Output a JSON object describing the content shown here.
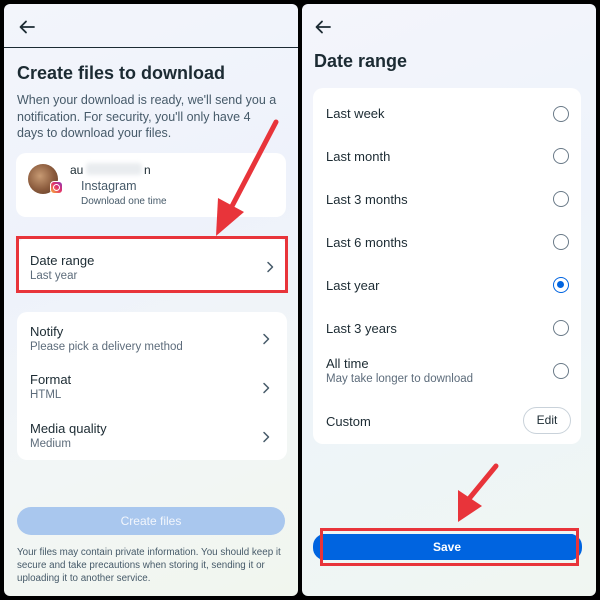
{
  "left": {
    "title": "Create files to download",
    "description": "When your download is ready, we'll send you a notification. For security, you'll only have 4 days to download your files.",
    "account": {
      "name_start": "au",
      "name_end": "n",
      "platform": "Instagram",
      "download_note": "Download one time"
    },
    "date_range": {
      "label": "Date range",
      "value": "Last year"
    },
    "settings": [
      {
        "label": "Notify",
        "value": "Please pick a delivery method"
      },
      {
        "label": "Format",
        "value": "HTML"
      },
      {
        "label": "Media quality",
        "value": "Medium"
      }
    ],
    "create_button": "Create files",
    "footer": "Your files may contain private information. You should keep it secure and take precautions when storing it, sending it or uploading it to another service."
  },
  "right": {
    "title": "Date range",
    "options": [
      {
        "label": "Last week",
        "selected": false
      },
      {
        "label": "Last month",
        "selected": false
      },
      {
        "label": "Last 3 months",
        "selected": false
      },
      {
        "label": "Last 6 months",
        "selected": false
      },
      {
        "label": "Last year",
        "selected": true
      },
      {
        "label": "Last 3 years",
        "selected": false
      },
      {
        "label": "All time",
        "sub": "May take longer to download",
        "selected": false
      }
    ],
    "custom": {
      "label": "Custom",
      "edit_label": "Edit"
    },
    "save_button": "Save"
  },
  "colors": {
    "accent": "#0064e0",
    "highlight": "#e8343a",
    "disabled_button": "#a9c7ee"
  }
}
